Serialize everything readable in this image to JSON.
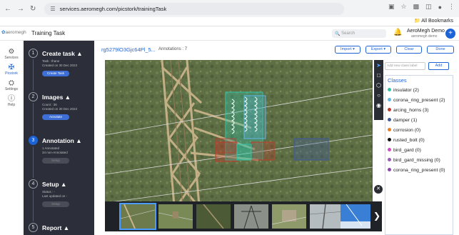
{
  "browser": {
    "url": "services.aeromegh.com/picstork/trainingTask",
    "bookmarks_label": "All Bookmarks"
  },
  "header": {
    "logo_text": "aeromegh",
    "page_title": "Training Task",
    "search_placeholder": "Search",
    "user_name": "AeroMegh Demo",
    "user_sub": "aeromegh demo"
  },
  "leftnav": [
    {
      "label": "Services",
      "icon": "services-icon"
    },
    {
      "label": "Picstork",
      "icon": "picstork-icon",
      "active": true
    },
    {
      "label": "Settings",
      "icon": "gear-icon"
    },
    {
      "label": "Help",
      "icon": "help-icon"
    }
  ],
  "steps": [
    {
      "num": "1",
      "title": "Create task",
      "lines": [
        "Task : thane",
        "Created on 30 Dec 2023"
      ],
      "button": "Create Task",
      "button_style": "blue"
    },
    {
      "num": "2",
      "title": "Images",
      "lines": [
        "Count : 36",
        "Created on 30 Dec 2023"
      ],
      "button": "Annotate",
      "button_style": "blue"
    },
    {
      "num": "3",
      "title": "Annotation",
      "lines": [
        "1 Annotated",
        "34 non-Annotated"
      ],
      "button": "Setup",
      "button_style": "grey",
      "current": true
    },
    {
      "num": "4",
      "title": "Setup",
      "lines": [
        "Status : -",
        "Last updated on -"
      ],
      "button": "Setup",
      "button_style": "grey"
    },
    {
      "num": "5",
      "title": "Report",
      "lines": [],
      "button": "",
      "button_style": "grey"
    }
  ],
  "toolbar": {
    "file_name": "rg5279lO3Gjc64Pl_5...",
    "annotations_label": "Annotations : 7",
    "import_label": "Import",
    "export_label": "Export",
    "clear_label": "Clear",
    "done_label": "Done"
  },
  "class_panel": {
    "new_class_placeholder": "Add new class label",
    "add_label": "Add",
    "title": "Classes",
    "classes": [
      {
        "name": "insulator (2)",
        "color": "#2ec4a6"
      },
      {
        "name": "corona_ring_present (2)",
        "color": "#5fb8e8"
      },
      {
        "name": "arcing_horns (3)",
        "color": "#c0392b"
      },
      {
        "name": "damper (1)",
        "color": "#3d5a9c"
      },
      {
        "name": "corrosion (0)",
        "color": "#e67e22"
      },
      {
        "name": "rusted_bolt (0)",
        "color": "#111111"
      },
      {
        "name": "bird_gard (0)",
        "color": "#d147c5"
      },
      {
        "name": "bird_gard_missing (0)",
        "color": "#9b59b6"
      },
      {
        "name": "corona_ring_present (0)",
        "color": "#8e44ad"
      }
    ]
  },
  "thumbnails": [
    {
      "theme": "grass",
      "selected": true
    },
    {
      "theme": "grass"
    },
    {
      "theme": "grass-dark"
    },
    {
      "theme": "tower"
    },
    {
      "theme": "grass"
    },
    {
      "theme": "tower-light"
    },
    {
      "theme": "sky"
    }
  ]
}
